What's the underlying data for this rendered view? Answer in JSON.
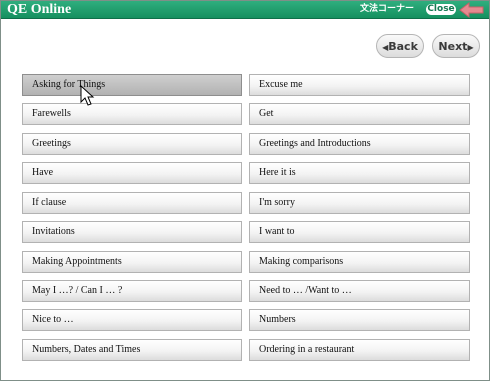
{
  "app": {
    "title": "QE Online",
    "corner_label": "文法コーナー",
    "close_label": "Close"
  },
  "nav": {
    "back_label": "Back",
    "next_label": "Next"
  },
  "topics_left": [
    "Asking for Things",
    "Farewells",
    "Greetings",
    "Have",
    "If clause",
    "Invitations",
    "Making Appointments",
    "May I …? / Can I … ?",
    "Nice to …",
    "Numbers, Dates and Times"
  ],
  "topics_right": [
    "Excuse me",
    "Get",
    "Greetings and Introductions",
    "Here it is",
    "I'm sorry",
    "I want to",
    "Making comparisons",
    "Need to … /Want to …",
    "Numbers",
    "Ordering in a restaurant"
  ],
  "selected_topic": "Asking for Things",
  "colors": {
    "titlebar": "#1a9a69",
    "close_arrow": "#e07f86"
  }
}
